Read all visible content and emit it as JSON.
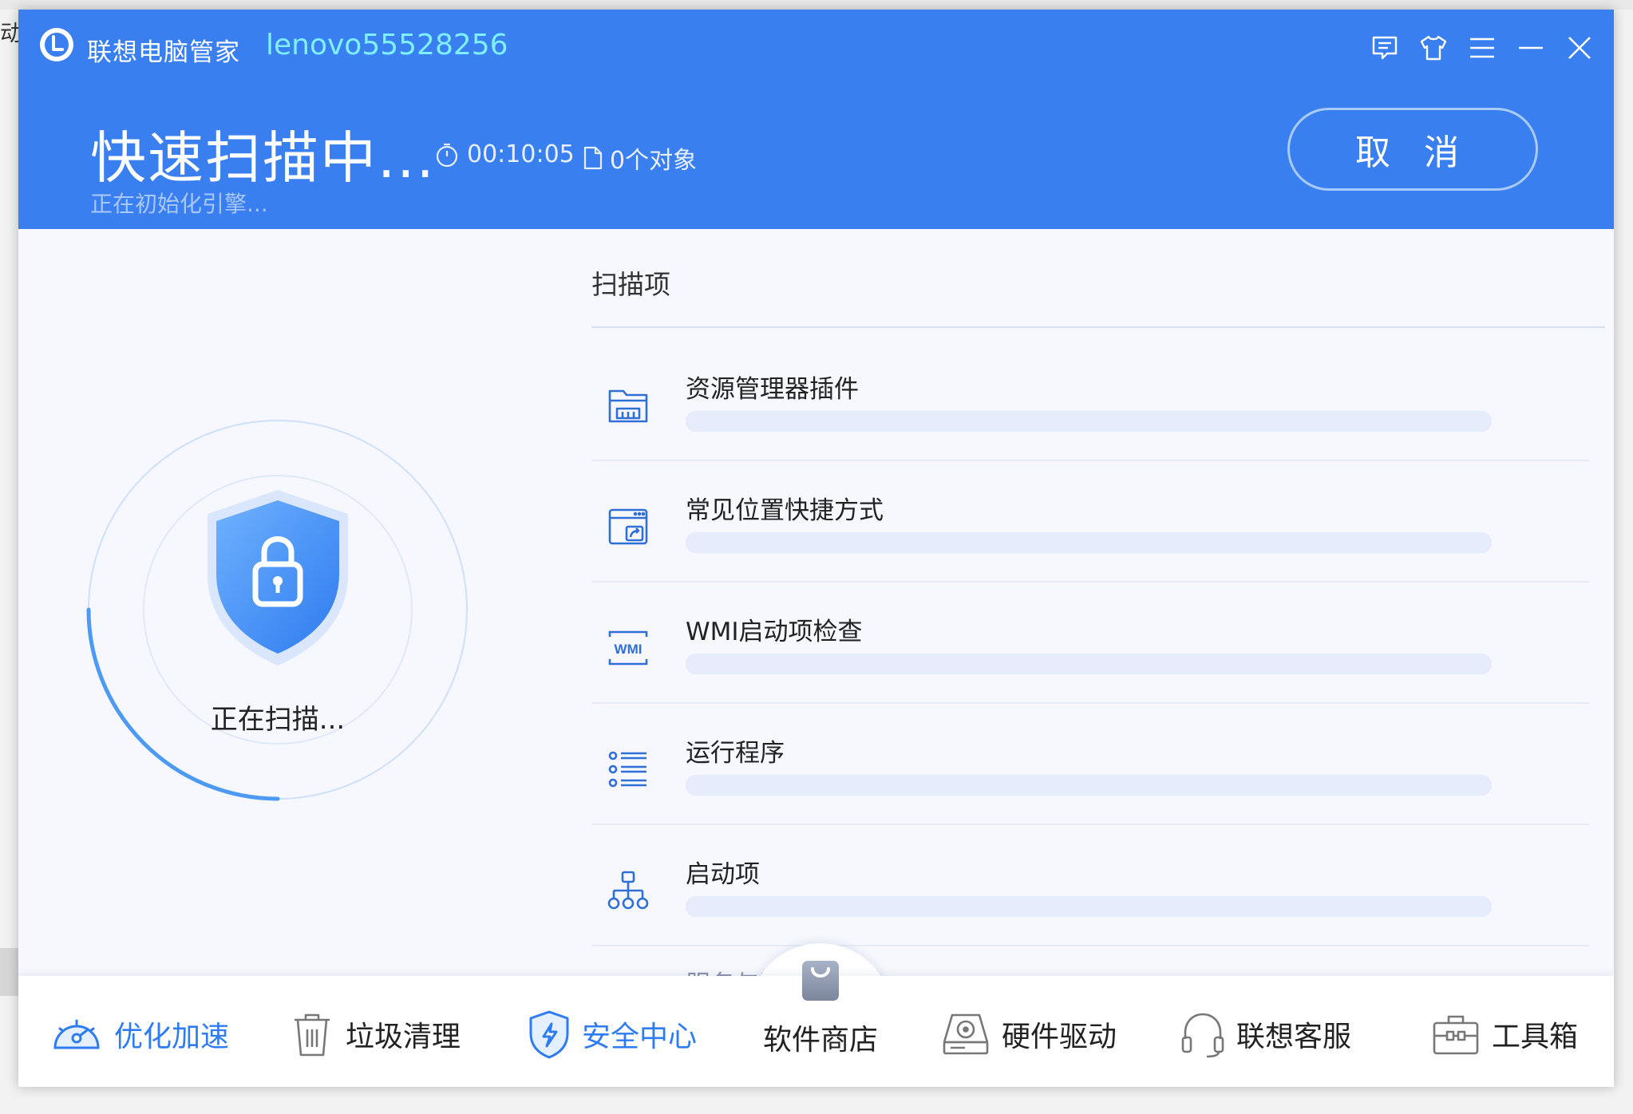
{
  "background": {
    "partial_text": "动"
  },
  "window": {
    "app_title": "联想电脑管家",
    "user_name": "lenovo55528256"
  },
  "header": {
    "scan_title": "快速扫描中...",
    "elapsed_time": "00:10:05",
    "object_count": "0个对象",
    "status_text": "正在初始化引擎...",
    "cancel_label": "取 消"
  },
  "scan_visual": {
    "label": "正在扫描..."
  },
  "scan_list": {
    "title": "扫描项",
    "items": [
      {
        "label": "资源管理器插件",
        "icon": "folder-icon"
      },
      {
        "label": "常见位置快捷方式",
        "icon": "shortcut-icon"
      },
      {
        "label": "WMI启动项检查",
        "icon": "wmi-icon"
      },
      {
        "label": "运行程序",
        "icon": "list-icon"
      },
      {
        "label": "启动项",
        "icon": "tree-icon"
      }
    ],
    "partial_next": "服务与驱动"
  },
  "bottom_nav": {
    "items": [
      {
        "label": "优化加速",
        "icon": "speedometer-icon",
        "active": true
      },
      {
        "label": "垃圾清理",
        "icon": "trash-icon",
        "active": false
      },
      {
        "label": "安全中心",
        "icon": "shield-icon",
        "active": true
      },
      {
        "label": "软件商店",
        "icon": "shopping-bag-icon",
        "active": false
      },
      {
        "label": "硬件驱动",
        "icon": "hard-drive-icon",
        "active": false
      },
      {
        "label": "联想客服",
        "icon": "headset-icon",
        "active": false
      },
      {
        "label": "工具箱",
        "icon": "toolbox-icon",
        "active": false
      }
    ]
  },
  "colors": {
    "header_blue": "#3a7ff0",
    "accent_cyan": "#7ef0ff",
    "nav_active": "#2f7bf0"
  }
}
